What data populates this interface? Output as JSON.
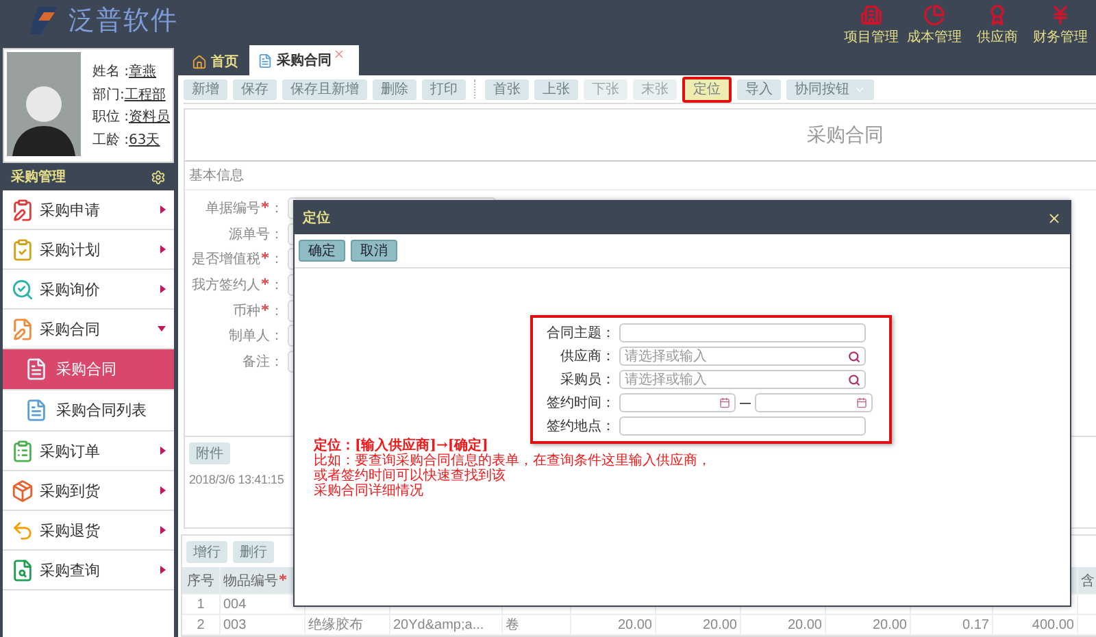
{
  "header": {
    "logo_text": "泛普软件",
    "nav": [
      {
        "label": "项目管理"
      },
      {
        "label": "成本管理"
      },
      {
        "label": "供应商"
      },
      {
        "label": "财务管理"
      }
    ]
  },
  "profile": {
    "fields": [
      {
        "label": "姓名 :",
        "value": "章燕"
      },
      {
        "label": "部门:",
        "value": "工程部"
      },
      {
        "label": "职位 :",
        "value": "资料员"
      },
      {
        "label": "工龄 :",
        "value": "63天"
      }
    ]
  },
  "sidebar": {
    "title": "采购管理",
    "items": [
      {
        "label": "采购申请",
        "expanded": false
      },
      {
        "label": "采购计划",
        "expanded": false
      },
      {
        "label": "采购询价",
        "expanded": false
      },
      {
        "label": "采购合同",
        "expanded": true,
        "children": [
          {
            "label": "采购合同",
            "selected": true
          },
          {
            "label": "采购合同列表",
            "selected": false
          }
        ]
      },
      {
        "label": "采购订单",
        "expanded": false
      },
      {
        "label": "采购到货",
        "expanded": false
      },
      {
        "label": "采购退货",
        "expanded": false
      },
      {
        "label": "采购查询",
        "expanded": false
      }
    ]
  },
  "tabs": [
    {
      "label": "首页",
      "selected": false,
      "closable": false
    },
    {
      "label": "采购合同",
      "selected": true,
      "closable": true
    }
  ],
  "toolbar": {
    "groups": [
      [
        {
          "label": "新增",
          "disabled": false,
          "highlighted": false
        },
        {
          "label": "保存",
          "disabled": false,
          "highlighted": false
        },
        {
          "label": "保存且新增",
          "disabled": false,
          "highlighted": false
        },
        {
          "label": "删除",
          "disabled": false,
          "highlighted": false
        },
        {
          "label": "打印",
          "disabled": false,
          "highlighted": false
        }
      ],
      [
        {
          "label": "首张",
          "disabled": false,
          "highlighted": false
        },
        {
          "label": "上张",
          "disabled": false,
          "highlighted": false
        },
        {
          "label": "下张",
          "disabled": true,
          "highlighted": false
        },
        {
          "label": "末张",
          "disabled": true,
          "highlighted": false
        },
        {
          "label": "定位",
          "disabled": false,
          "highlighted": true
        },
        {
          "label": "导入",
          "disabled": false,
          "highlighted": false
        },
        {
          "label": "协同按钮",
          "disabled": false,
          "highlighted": false,
          "dropdown": true
        }
      ]
    ]
  },
  "form": {
    "title": "采购合同",
    "section": "基本信息",
    "colon": "：",
    "fields": [
      {
        "label": "单据编号",
        "required": true
      },
      {
        "label": "源单号",
        "required": false
      },
      {
        "label": "是否增值税",
        "required": true
      },
      {
        "label": "我方签约人",
        "required": true
      },
      {
        "label": "币种",
        "required": true
      },
      {
        "label": "制单人",
        "required": false
      },
      {
        "label": "备注",
        "required": false
      }
    ],
    "attach_button": "附件",
    "timestamp": "2018/3/6 13:41:15"
  },
  "detail": {
    "buttons": [
      "增行",
      "删行"
    ],
    "columns": [
      {
        "label": "序号",
        "required": false
      },
      {
        "label": "物品编号",
        "required": true
      },
      {
        "label": "含",
        "required": false
      }
    ],
    "rows": [
      {
        "cells": [
          "1",
          "004"
        ]
      },
      {
        "cells": [
          "2",
          "003",
          "绝缘胶布",
          "20Yd&amp;a...",
          "卷",
          "20.00",
          "20.00",
          "20.00",
          "20.00",
          "0.17",
          "400.00"
        ]
      }
    ]
  },
  "dialog": {
    "title": "定位",
    "buttons": [
      "确定",
      "取消"
    ],
    "fields": [
      {
        "label": "合同主题：",
        "kind": "text"
      },
      {
        "label": "供应商：",
        "kind": "lookup",
        "placeholder": "请选择或输入"
      },
      {
        "label": "采购员：",
        "kind": "lookup",
        "placeholder": "请选择或输入"
      },
      {
        "label": "签约时间：",
        "kind": "daterange"
      },
      {
        "label": "签约地点：",
        "kind": "text"
      }
    ],
    "note": [
      "定位：[输入供应商]→[确定]",
      "比如：要查询采购合同信息的表单，在查询条件这里输入供应商，",
      "或者签约时间可以快速查找到该",
      "采购合同详细情况"
    ]
  }
}
